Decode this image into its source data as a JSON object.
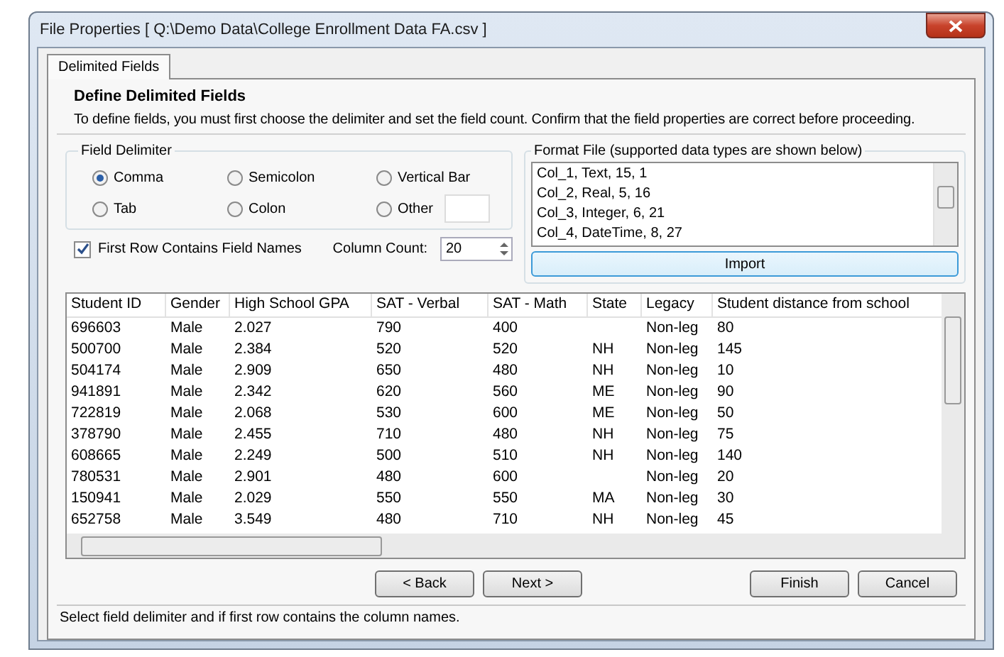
{
  "window": {
    "title": "File Properties [ Q:\\Demo Data\\College Enrollment Data FA.csv ]"
  },
  "tabs": [
    {
      "label": "Delimited Fields",
      "selected": true
    }
  ],
  "heading": "Define Delimited Fields",
  "description": "To define fields, you must first choose the delimiter and set the field count.  Confirm that the field properties are correct before proceeding.",
  "field_delimiter": {
    "title": "Field Delimiter",
    "options": [
      {
        "label": "Comma",
        "selected": true,
        "kind": "plain"
      },
      {
        "label": "Semicolon",
        "selected": false,
        "kind": "plain"
      },
      {
        "label": "Vertical Bar",
        "selected": false,
        "kind": "plain"
      },
      {
        "label": "Tab",
        "selected": false,
        "kind": "plain"
      },
      {
        "label": "Colon",
        "selected": false,
        "kind": "plain"
      },
      {
        "label": "Other",
        "selected": false,
        "kind": "with_field"
      }
    ]
  },
  "first_row_names": {
    "label": "First Row Contains Field Names",
    "checked": true
  },
  "column_count": {
    "label": "Column Count:",
    "value": "20"
  },
  "format_file": {
    "title": "Format File (supported data types are shown below)",
    "lines": [
      "Col_1, Text, 15, 1",
      "Col_2, Real, 5, 16",
      "Col_3, Integer, 6, 21",
      "Col_4, DateTime, 8, 27"
    ],
    "import_button": "Import"
  },
  "grid": {
    "columns": [
      "Student ID",
      "Gender",
      "High School GPA",
      "SAT - Verbal",
      "SAT - Math",
      "State",
      "Legacy",
      "Student distance from school"
    ],
    "rows": [
      [
        "696603",
        "Male",
        "2.027",
        "790",
        "400",
        "",
        "Non-leg",
        "80"
      ],
      [
        "500700",
        "Male",
        "2.384",
        "520",
        "520",
        "NH",
        "Non-leg",
        "145"
      ],
      [
        "504174",
        "Male",
        "2.909",
        "650",
        "480",
        "NH",
        "Non-leg",
        "10"
      ],
      [
        "941891",
        "Male",
        "2.342",
        "620",
        "560",
        "ME",
        "Non-leg",
        "90"
      ],
      [
        "722819",
        "Male",
        "2.068",
        "530",
        "600",
        "ME",
        "Non-leg",
        "50"
      ],
      [
        "378790",
        "Male",
        "2.455",
        "710",
        "480",
        "NH",
        "Non-leg",
        "75"
      ],
      [
        "608665",
        "Male",
        "2.249",
        "500",
        "510",
        "NH",
        "Non-leg",
        "140"
      ],
      [
        "780531",
        "Male",
        "2.901",
        "480",
        "600",
        "",
        "Non-leg",
        "20"
      ],
      [
        "150941",
        "Male",
        "2.029",
        "550",
        "550",
        "MA",
        "Non-leg",
        "30"
      ],
      [
        "652758",
        "Male",
        "3.549",
        "480",
        "710",
        "NH",
        "Non-leg",
        "45"
      ]
    ]
  },
  "nav_buttons": [
    "< Back",
    "Next >"
  ],
  "action_buttons": [
    "Finish",
    "Cancel"
  ],
  "status_bar": "Select field delimiter and if first row contains the column names."
}
